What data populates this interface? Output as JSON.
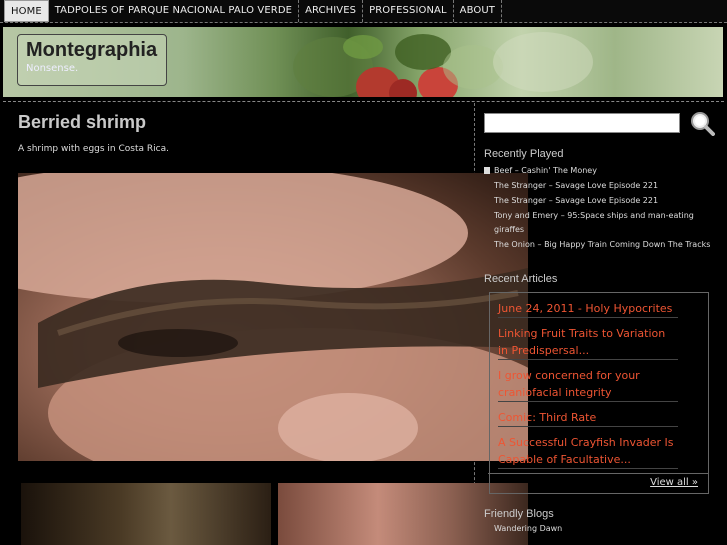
{
  "nav": {
    "items": [
      {
        "label": "HOME"
      },
      {
        "label": "TADPOLES OF PARQUE NACIONAL PALO VERDE"
      },
      {
        "label": "ARCHIVES"
      },
      {
        "label": "PROFESSIONAL"
      },
      {
        "label": "ABOUT"
      }
    ]
  },
  "header": {
    "site_title": "Montegraphia",
    "tagline": "Nonsense."
  },
  "post": {
    "title": "Berried shrimp",
    "description": "A shrimp with eggs in Costa Rica."
  },
  "search": {
    "value": "",
    "button_icon": "magnifier-icon"
  },
  "recently_played": {
    "heading": "Recently Played",
    "items": [
      "Beef – Cashin' The Money",
      "The Stranger – Savage Love Episode 221",
      "The Stranger – Savage Love Episode 221",
      "Tony and Emery – 95:Space ships and man-eating giraffes",
      "The Onion – Big Happy Train Coming Down The Tracks"
    ]
  },
  "recent_articles": {
    "heading": "Recent Articles",
    "items": [
      "June 24, 2011 - Holy Hypocrites",
      "Linking Fruit Traits to Variation in Predispersal...",
      "I grow concerned for your craniofacial integrity",
      "Comic: Third Rate",
      "A Successful Crayfish Invader Is Capable of Facultative..."
    ],
    "view_all": "View all »"
  },
  "friendly_blogs": {
    "heading": "Friendly Blogs",
    "items": [
      "Wandering Dawn"
    ]
  },
  "colors": {
    "background": "#000000",
    "link_accent": "#ee5533",
    "nav_active_bg": "#e8e8e8"
  }
}
